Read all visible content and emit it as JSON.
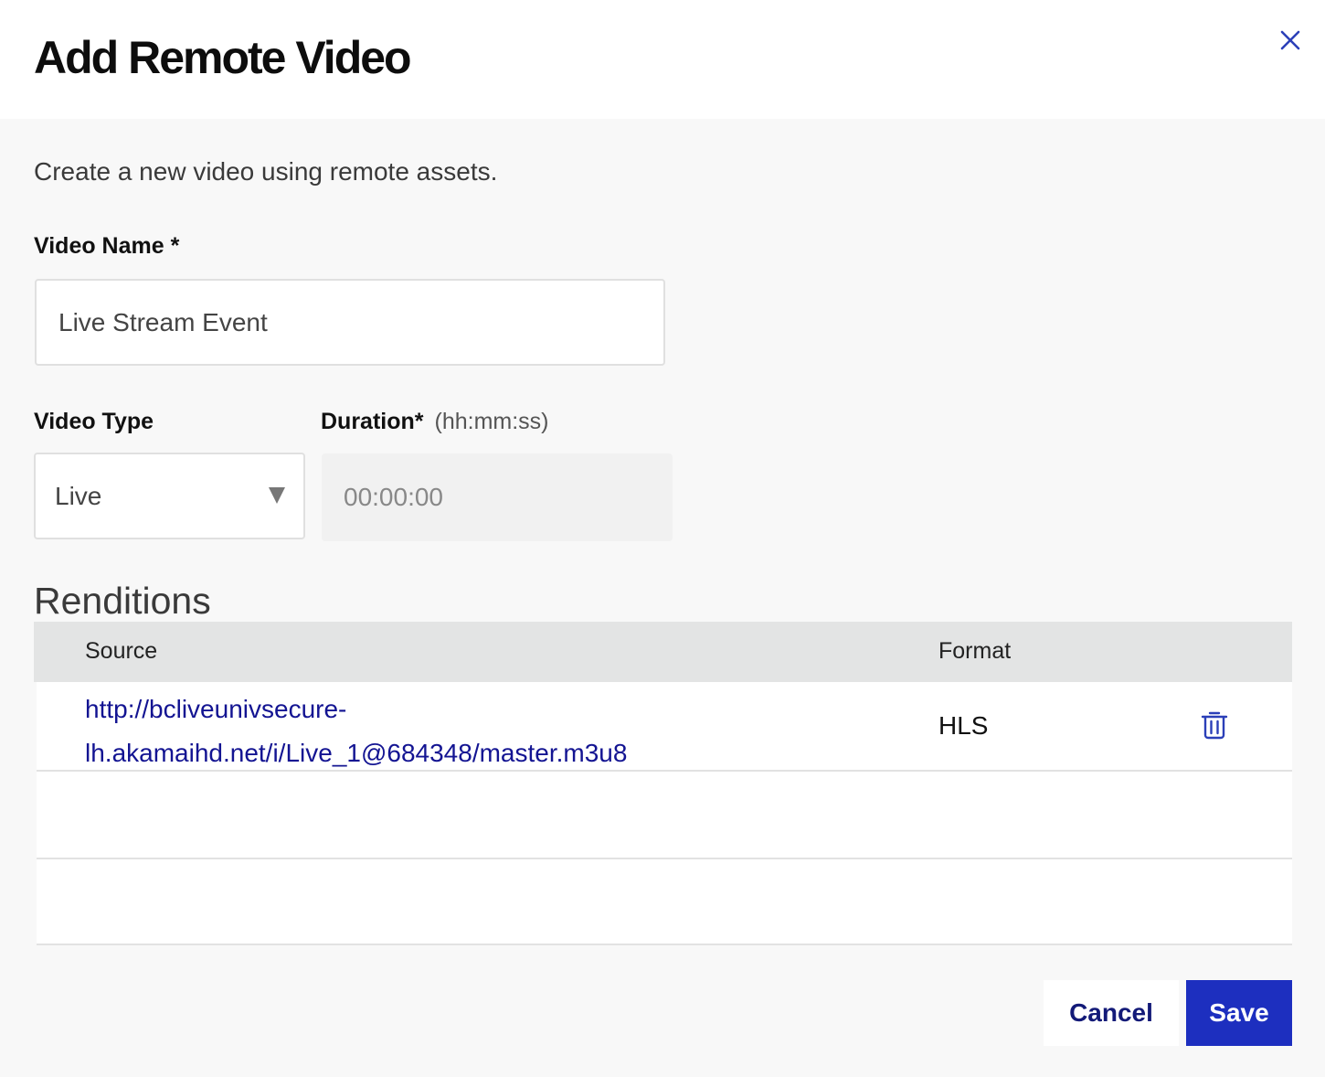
{
  "dialog": {
    "title": "Add Remote Video",
    "description": "Create a new video using remote assets."
  },
  "form": {
    "video_name_label": "Video Name *",
    "video_name_value": "Live Stream Event",
    "video_type_label": "Video Type",
    "video_type_value": "Live",
    "duration_label": "Duration*",
    "duration_hint": "(hh:mm:ss)",
    "duration_value": "00:00:00"
  },
  "renditions": {
    "title": "Renditions",
    "columns": [
      "Source",
      "Format"
    ],
    "rows": [
      {
        "source_line1": "http://bcliveunivsecure-",
        "source_line2": "lh.akamaihd.net/i/Live_1@684348/master.m3u8",
        "format": "HLS"
      }
    ]
  },
  "actions": {
    "cancel": "Cancel",
    "save": "Save"
  },
  "icons": {
    "close": "close-icon",
    "dropdown": "chevron-down-icon",
    "delete": "trash-icon"
  },
  "colors": {
    "accent": "#1d2fbf",
    "link": "#131492",
    "cancel_text": "#131a78",
    "close_icon": "#2b3fb8"
  }
}
